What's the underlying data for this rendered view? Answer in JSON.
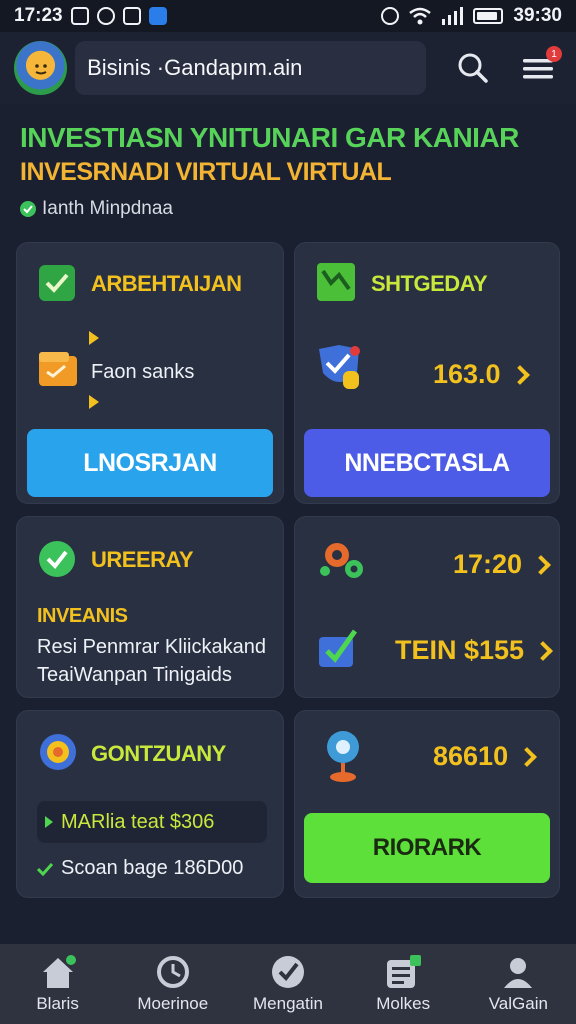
{
  "status_bar": {
    "time": "17:23",
    "clock_right": "39:30",
    "icons": [
      "grid-icon",
      "circle-icon",
      "chat-icon",
      "app-icon",
      "alarm-icon",
      "wifi-icon",
      "signal-icon",
      "battery-icon"
    ]
  },
  "header": {
    "app_name": "Bisinis  ·Gandapım.ain",
    "notification_count": "1",
    "logo_icon": "lion-shield-icon"
  },
  "hero": {
    "title": "INVESTIASN YNITUNARI GAR KANIAR",
    "subtitle": "INVESRNADI VIRTUAL VIRTUAL",
    "note": "Ianth Minpdnaa"
  },
  "cards": {
    "c1": {
      "title": "ARBEHTAIJAN",
      "row_text": "Faon sanks",
      "button": "LNOSRJAN"
    },
    "c2": {
      "title": "SHTGEDAY",
      "value": "163.0",
      "button": "NNEBCTASLA"
    },
    "c3": {
      "title": "UREERAY",
      "sub_title": "INVEANIS",
      "line1": "Resi Penmrar Kliickakand",
      "line2": "TeaiWanpan Tinigaids"
    },
    "c4": {
      "value": "17:20",
      "value2": "TEIN $155"
    },
    "c5": {
      "title": "GONTZUANY",
      "field": "MARlia teat $306",
      "note": "Scoan bage 186D00"
    },
    "c6": {
      "value": "86610",
      "button": "RIORARK"
    }
  },
  "bottom_nav": [
    {
      "label": "Blaris",
      "icon": "home-icon"
    },
    {
      "label": "Moerinoe",
      "icon": "clock-icon"
    },
    {
      "label": "Mengatin",
      "icon": "check-circle-icon"
    },
    {
      "label": "Molkes",
      "icon": "list-icon"
    },
    {
      "label": "ValGain",
      "icon": "user-icon"
    }
  ],
  "colors": {
    "background": "#1b2030",
    "card": "#283042",
    "accent_yellow": "#f2c11e",
    "accent_green": "#58d35a",
    "button_blue": "#29a4ec",
    "button_indigo": "#4c5ce6",
    "button_lime": "#5ee03b"
  }
}
